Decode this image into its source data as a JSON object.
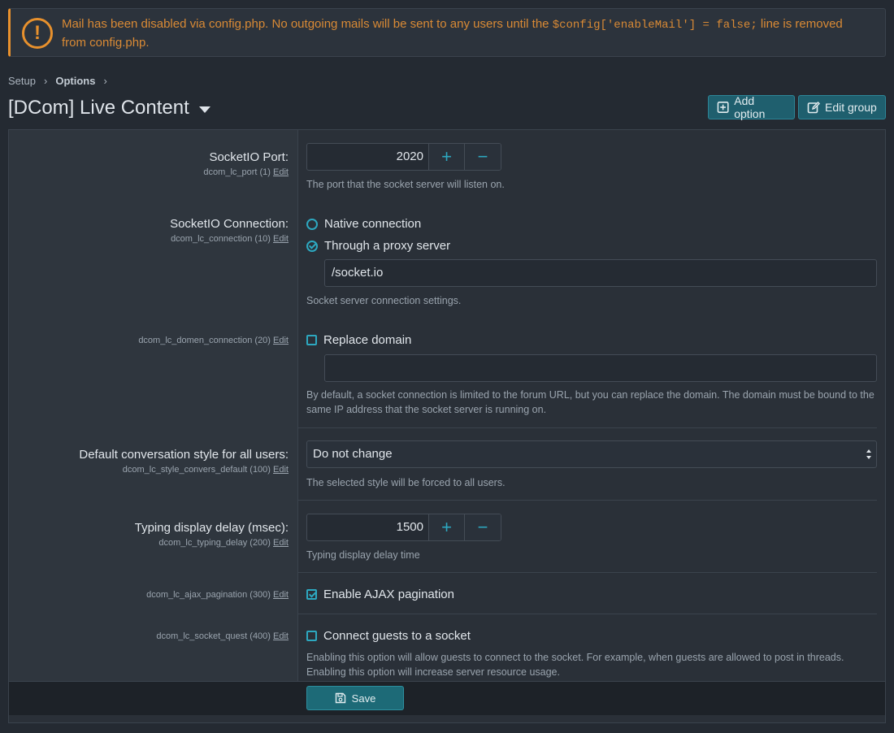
{
  "notice": {
    "text_before": "Mail has been disabled via config.php. No outgoing mails will be sent to any users until the ",
    "code": "$config['enableMail'] = false;",
    "text_after": " line is removed from config.php."
  },
  "breadcrumb": {
    "items": [
      "Setup",
      "Options"
    ]
  },
  "header": {
    "title": "[DCom] Live Content",
    "add_option": "Add option",
    "edit_group": "Edit group"
  },
  "options": {
    "port": {
      "label": "SocketIO Port:",
      "key": "dcom_lc_port (1)",
      "edit": "Edit",
      "value": "2020",
      "explain": "The port that the socket server will listen on."
    },
    "connection": {
      "label": "SocketIO Connection:",
      "key": "dcom_lc_connection (10)",
      "edit": "Edit",
      "native": "Native connection",
      "proxy": "Through a proxy server",
      "proxy_value": "/socket.io",
      "explain": "Socket server connection settings."
    },
    "domain": {
      "key": "dcom_lc_domen_connection (20)",
      "edit": "Edit",
      "checkbox": "Replace domain",
      "value": "",
      "explain": "By default, a socket connection is limited to the forum URL, but you can replace the domain. The domain must be bound to the same IP address that the socket server is running on."
    },
    "style": {
      "label": "Default conversation style for all users:",
      "key": "dcom_lc_style_convers_default (100)",
      "edit": "Edit",
      "selected": "Do not change",
      "explain": "The selected style will be forced to all users."
    },
    "typing": {
      "label": "Typing display delay (msec):",
      "key": "dcom_lc_typing_delay (200)",
      "edit": "Edit",
      "value": "1500",
      "explain": "Typing display delay time"
    },
    "ajax": {
      "key": "dcom_lc_ajax_pagination (300)",
      "edit": "Edit",
      "checkbox": "Enable AJAX pagination"
    },
    "guest": {
      "key": "dcom_lc_socket_quest (400)",
      "edit": "Edit",
      "checkbox": "Connect guests to a socket",
      "explain": "Enabling this option will allow guests to connect to the socket. For example, when guests are allowed to post in threads. Enabling this option will increase server resource usage."
    }
  },
  "footer": {
    "save": "Save"
  },
  "colors": {
    "accent": "#2da8c0",
    "warning": "#e8912d",
    "button": "#1f5f6e"
  }
}
